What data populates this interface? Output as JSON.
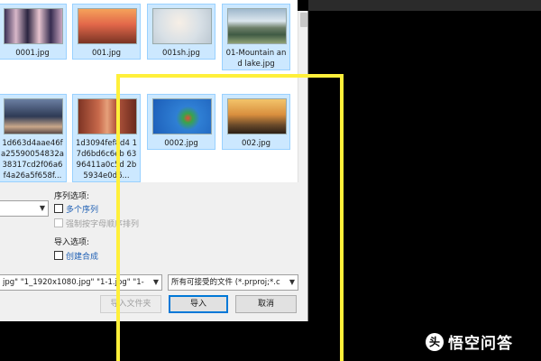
{
  "files": [
    {
      "name": "0001.jpg",
      "thumb": "girls-group"
    },
    {
      "name": "001.jpg",
      "thumb": "woman-sunset"
    },
    {
      "name": "001sh.jpg",
      "thumb": "woman-soft-light"
    },
    {
      "name": "01-Mountain and lake.jpg",
      "thumb": "mountain-lake"
    },
    {
      "name": "1d663d4aae46f a25590054832a 38317cd2f06a6 f4a26a5f658f...",
      "thumb": "city-street"
    },
    {
      "name": "1d3094fef8d4 17d6bd6c6eb 6396411a0c5d 2b5934e0d6...",
      "thumb": "red-canyon"
    },
    {
      "name": "0002.jpg",
      "thumb": "parrot-blue-sky"
    },
    {
      "name": "002.jpg",
      "thumb": "sunset-pier"
    }
  ],
  "sequence_options": {
    "label": "序列选项:",
    "multi_sequence": "多个序列",
    "force_alphabetical": "强制按字母顺序排列"
  },
  "import_options": {
    "label": "导入选项:",
    "create_composition": "创建合成"
  },
  "filename_field": "jpg\" \"1_1920x1080.jpg\" \"1-1.jpg\" \"1-",
  "filetype_select": "所有可接受的文件 (*.prproj;*.c",
  "buttons": {
    "import_folder": "导入文件夹",
    "import": "导入",
    "cancel": "取消"
  },
  "watermark": {
    "icon": "头",
    "text": "悟空问答"
  },
  "colors": {
    "highlight": "#fff03a",
    "selection": "#cce8ff"
  }
}
